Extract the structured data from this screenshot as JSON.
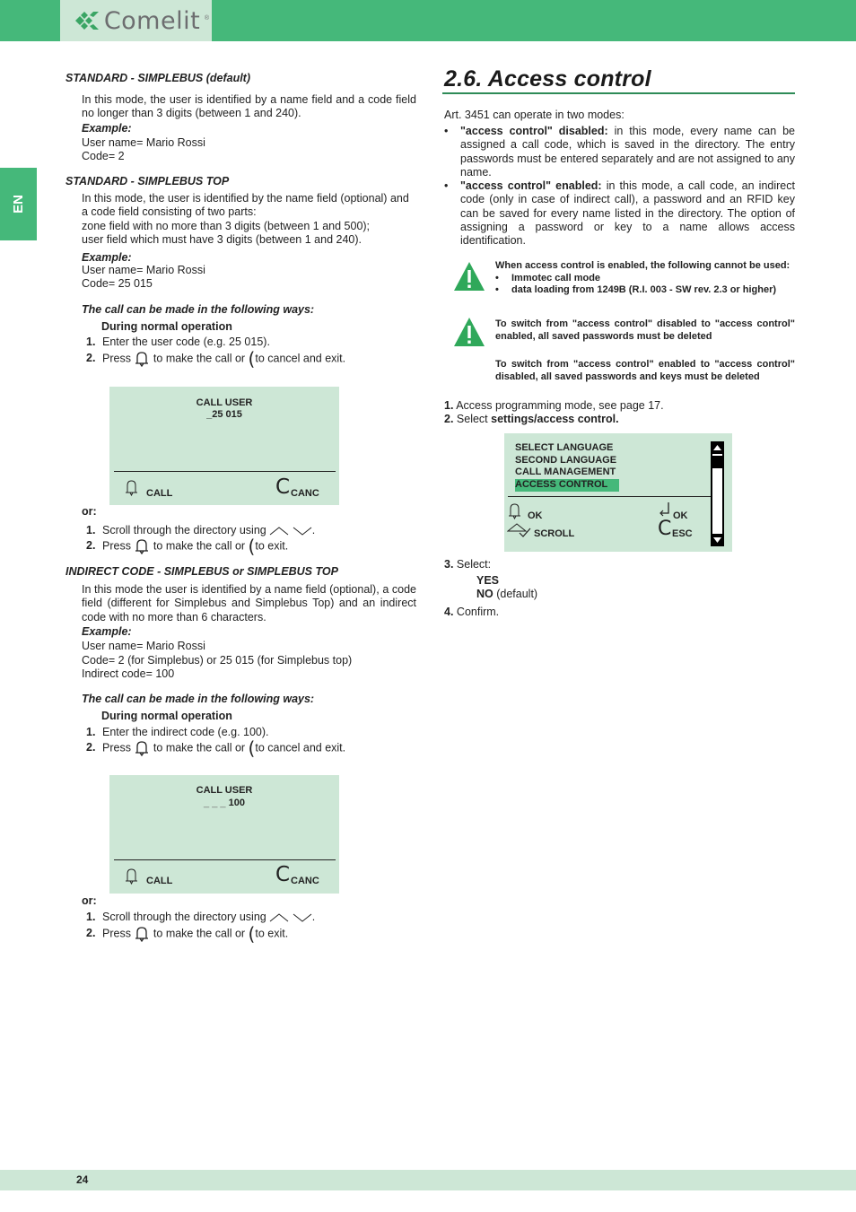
{
  "header": {
    "brand": "Comelit",
    "registered": "®"
  },
  "language_tab": "EN",
  "footer": {
    "page_number": "24"
  },
  "left": {
    "s1": {
      "heading": "STANDARD - SIMPLEBUS (default)",
      "text": "In this mode, the user is identified by a name field and a code field no longer than 3 digits (between 1 and 240).",
      "example_label": "Example:",
      "example_lines": [
        "User name= Mario Rossi",
        "Code= 2"
      ]
    },
    "s2": {
      "heading": "STANDARD - SIMPLEBUS TOP",
      "text_lines": [
        "In this mode, the user is identified by the name field (optional) and",
        "a code field consisting of two parts:",
        "zone field with no more than 3 digits (between 1 and 500);",
        "user field which must have 3 digits (between 1 and 240)."
      ],
      "example_label": "Example:",
      "example_lines": [
        "User name= Mario Rossi",
        "Code= 25 015"
      ]
    },
    "call1": {
      "intro": "The call can be made in the following ways:",
      "subhead": "During normal operation",
      "step1_num": "1.",
      "step1": "Enter the user code (e.g. 25 015).",
      "step2_num": "2.",
      "step2_a": "Press",
      "step2_b": "to make the call or",
      "step2_c": "to cancel and exit.",
      "lcd": {
        "title": "CALL USER",
        "value": "_25  015",
        "left_label": "CALL",
        "right_label": "CANC"
      },
      "or_label": "or:",
      "alt1_num": "1.",
      "alt1": "Scroll through the directory using",
      "alt1_end": ".",
      "alt2_num": "2.",
      "alt2_a": "Press",
      "alt2_b": "to make the call or",
      "alt2_c": "to exit."
    },
    "s3": {
      "heading": "INDIRECT CODE - SIMPLEBUS or SIMPLEBUS TOP",
      "text": "In this mode the user is identified by a name field (optional), a code field (different for Simplebus and Simplebus Top) and an indirect code with no more than 6 characters.",
      "example_label": "Example:",
      "example_lines": [
        "User name= Mario Rossi",
        "Code= 2 (for Simplebus) or 25 015 (for Simplebus top)",
        "Indirect code= 100"
      ]
    },
    "call2": {
      "intro": "The call can be made in the following ways:",
      "subhead": "During normal operation",
      "step1_num": "1.",
      "step1": "Enter the indirect code (e.g. 100).",
      "step2_num": "2.",
      "step2_a": "Press",
      "step2_b": "to make the call or",
      "step2_c": "to cancel and exit.",
      "lcd": {
        "title": "CALL USER",
        "value_prefix": "_ _ _",
        "value": "100",
        "left_label": "CALL",
        "right_label": "CANC"
      },
      "or_label": "or:",
      "alt1_num": "1.",
      "alt1": "Scroll through the directory using",
      "alt1_end": ".",
      "alt2_num": "2.",
      "alt2_a": "Press",
      "alt2_b": "to make the call or",
      "alt2_c": "to exit."
    }
  },
  "right": {
    "title": "2.6. Access control",
    "intro": "Art. 3451 can operate in two modes:",
    "bullets": [
      {
        "bold": "\"access control\" disabled:",
        "text": " in this mode, every name can be assigned a call code, which is saved in the directory. The entry passwords must be entered separately and are not assigned to any name."
      },
      {
        "bold": "\"access control\" enabled:",
        "text": " in this mode, a call code, an indirect code (only in case of indirect call), a password and an RFID key can be saved for every name listed in the directory. The option of assigning a password or key to a name allows access identification."
      }
    ],
    "warning1": {
      "text": "When access control is enabled, the following cannot be used:",
      "items": [
        "Immotec call mode",
        "data loading from 1249B (R.I. 003 - SW rev. 2.3 or higher)"
      ]
    },
    "warning2": {
      "p1": "To switch from \"access control\" disabled to \"access control\" enabled, all saved passwords must be deleted",
      "p2": "To switch from \"access control\" enabled to \"access control\" disabled, all saved passwords and keys must be deleted"
    },
    "steps": {
      "s1_num": "1.",
      "s1": " Access programming mode, see page 17.",
      "s2_num": "2.",
      "s2": " Select ",
      "s2_bold": "settings/access control.",
      "s3_num": "3.",
      "s3": " Select:",
      "opt_yes": "YES",
      "opt_no": "NO",
      "opt_no_suffix": " (default)",
      "s4_num": "4.",
      "s4": " Confirm."
    },
    "menu_lcd": {
      "items": [
        "SELECT LANGUAGE",
        "SECOND LANGUAGE",
        "CALL MANAGEMENT",
        "ACCESS CONTROL"
      ],
      "selected_index": 3,
      "bell_label": "OK",
      "scroll_label": "SCROLL",
      "enter_label": "OK",
      "esc_label": "ESC",
      "highlight_color": "#45b87a"
    }
  },
  "colors": {
    "brand_green": "#45b87a",
    "light_green": "#cde7d6"
  }
}
